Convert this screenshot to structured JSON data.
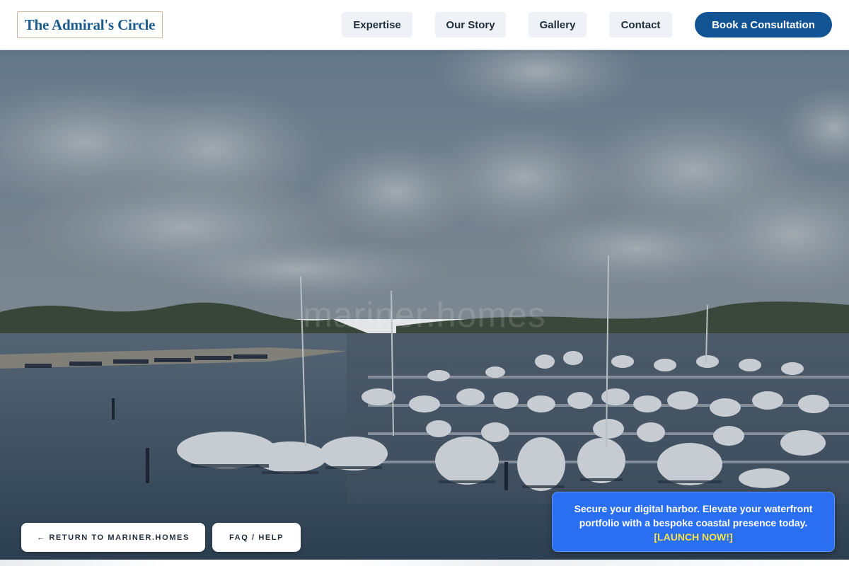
{
  "header": {
    "logo": "The Admiral's Circle",
    "nav": {
      "expertise": "Expertise",
      "our_story": "Our Story",
      "gallery": "Gallery",
      "contact": "Contact"
    },
    "cta": "Book a Consultation"
  },
  "hero": {
    "image": "marina-aerial-photo",
    "watermark": "mariner.homes"
  },
  "footer_buttons": {
    "return": "← RETURN TO MARINER.HOMES",
    "faq": "FAQ / HELP"
  },
  "promo": {
    "text": "Secure your digital harbor. Elevate your waterfront portfolio with a bespoke coastal presence today.",
    "link": "[LAUNCH NOW!]"
  },
  "colors": {
    "brand_blue": "#125493",
    "promo_blue": "#2a6ef2",
    "promo_link": "#f6e24a",
    "logo_text": "#1b5c8f"
  }
}
